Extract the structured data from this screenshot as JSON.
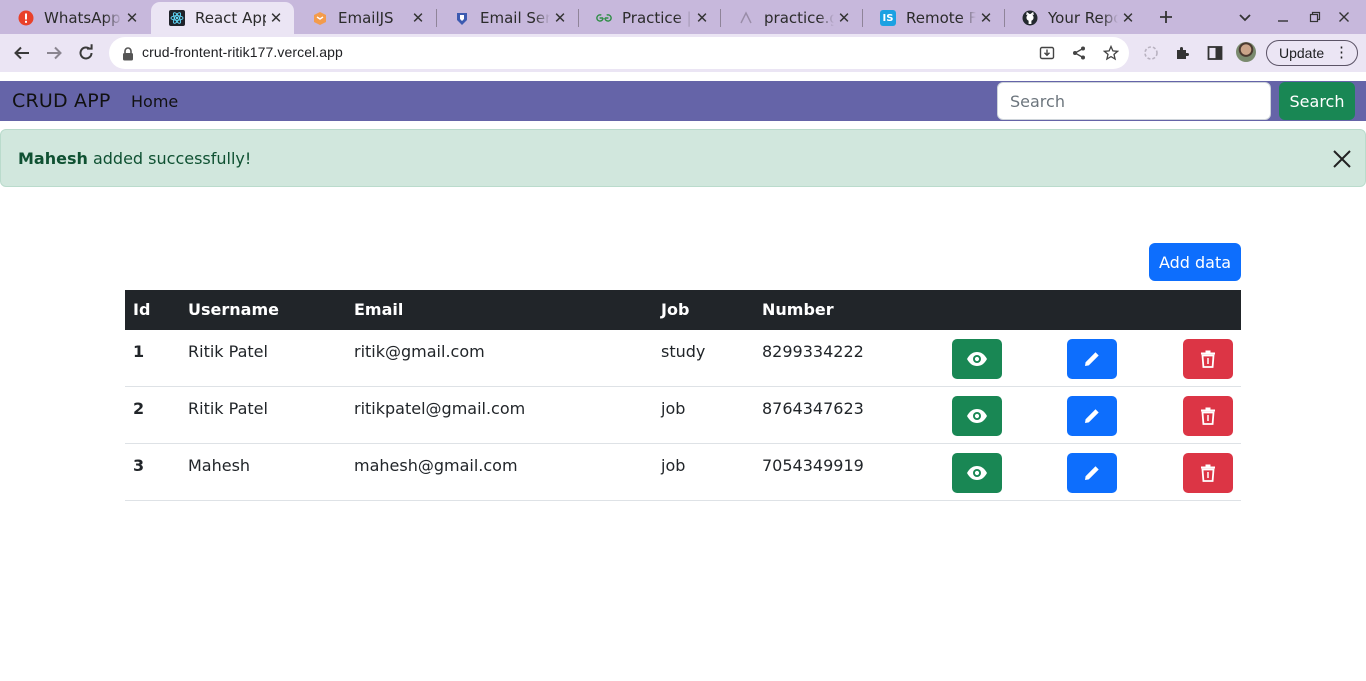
{
  "browser": {
    "tabs": [
      {
        "title": "WhatsApp",
        "icon": "whatsapp-icon",
        "active": false
      },
      {
        "title": "React App",
        "icon": "react-icon",
        "active": true
      },
      {
        "title": "EmailJS",
        "icon": "emailjs-icon",
        "active": false
      },
      {
        "title": "Email Servi",
        "icon": "email-service-icon",
        "active": false
      },
      {
        "title": "Practice | G",
        "icon": "gfg-icon",
        "active": false
      },
      {
        "title": "practice.ge",
        "icon": "globe-icon",
        "active": false
      },
      {
        "title": "Remote Ful",
        "icon": "is-icon",
        "active": false
      },
      {
        "title": "Your Repos",
        "icon": "github-icon",
        "active": false
      }
    ],
    "url": "crud-frontent-ritik177.vercel.app",
    "update_label": "Update"
  },
  "navbar": {
    "brand": "CRUD APP",
    "home": "Home",
    "search_placeholder": "Search",
    "search_button": "Search",
    "color": "#6564a8"
  },
  "alert": {
    "name": "Mahesh",
    "message": "added successfully!"
  },
  "add_button": "Add data",
  "table": {
    "headers": [
      "Id",
      "Username",
      "Email",
      "Job",
      "Number"
    ],
    "rows": [
      {
        "id": "1",
        "username": "Ritik Patel",
        "email": "ritik@gmail.com",
        "job": "study",
        "number": "8299334222"
      },
      {
        "id": "2",
        "username": "Ritik Patel",
        "email": "ritikpatel@gmail.com",
        "job": "job",
        "number": "8764347623"
      },
      {
        "id": "3",
        "username": "Mahesh",
        "email": "mahesh@gmail.com",
        "job": "job",
        "number": "7054349919"
      }
    ],
    "actions": [
      "view-icon",
      "edit-icon",
      "delete-icon"
    ]
  },
  "colors": {
    "success": "#198754",
    "primary": "#0d6efd",
    "danger": "#dc3545",
    "alert_bg": "#d1e7dd"
  }
}
